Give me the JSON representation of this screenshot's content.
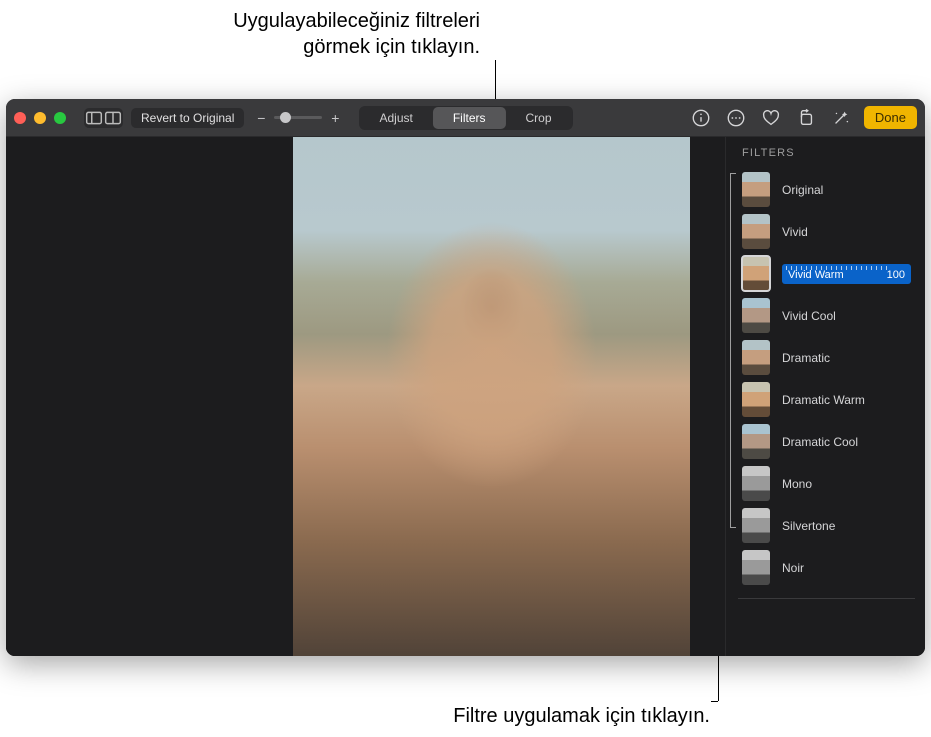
{
  "callouts": {
    "top": "Uygulayabileceğiniz filtreleri\ngörmek için tıklayın.",
    "bottom": "Filtre uygulamak için tıklayın."
  },
  "toolbar": {
    "revert_label": "Revert to Original",
    "segments": {
      "adjust": "Adjust",
      "filters": "Filters",
      "crop": "Crop"
    },
    "done_label": "Done"
  },
  "sidebar": {
    "title": "FILTERS",
    "selected_value": "100",
    "filters": [
      {
        "name": "Original",
        "tone": "std"
      },
      {
        "name": "Vivid",
        "tone": "std"
      },
      {
        "name": "Vivid Warm",
        "tone": "warm",
        "selected": true
      },
      {
        "name": "Vivid Cool",
        "tone": "cool"
      },
      {
        "name": "Dramatic",
        "tone": "std"
      },
      {
        "name": "Dramatic Warm",
        "tone": "warm"
      },
      {
        "name": "Dramatic Cool",
        "tone": "cool"
      },
      {
        "name": "Mono",
        "tone": "mono"
      },
      {
        "name": "Silvertone",
        "tone": "mono"
      },
      {
        "name": "Noir",
        "tone": "mono"
      }
    ]
  }
}
